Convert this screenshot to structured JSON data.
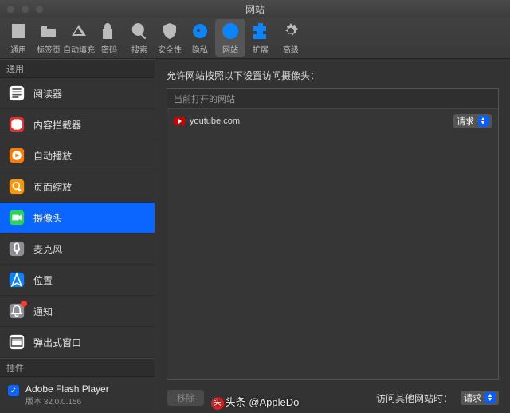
{
  "window": {
    "title": "网站"
  },
  "toolbar": {
    "items": [
      {
        "id": "general",
        "label": "通用",
        "selected": false
      },
      {
        "id": "tabs",
        "label": "标签页",
        "selected": false
      },
      {
        "id": "autofill",
        "label": "自动填充",
        "selected": false
      },
      {
        "id": "passwords",
        "label": "密码",
        "selected": false
      },
      {
        "id": "search",
        "label": "搜索",
        "selected": false
      },
      {
        "id": "security",
        "label": "安全性",
        "selected": false
      },
      {
        "id": "privacy",
        "label": "隐私",
        "selected": false
      },
      {
        "id": "websites",
        "label": "网站",
        "selected": true
      },
      {
        "id": "extensions",
        "label": "扩展",
        "selected": false
      },
      {
        "id": "advanced",
        "label": "高级",
        "selected": false
      }
    ]
  },
  "sidebar": {
    "general_header": "通用",
    "plugins_header": "插件",
    "items": [
      {
        "id": "reader",
        "label": "阅读器",
        "color": "#ffffff",
        "selected": false
      },
      {
        "id": "blockers",
        "label": "内容拦截器",
        "color": "#e03030",
        "selected": false
      },
      {
        "id": "autoplay",
        "label": "自动播放",
        "color": "#ff7a00",
        "selected": false
      },
      {
        "id": "zoom",
        "label": "页面缩放",
        "color": "#ff9500",
        "selected": false
      },
      {
        "id": "camera",
        "label": "摄像头",
        "color": "#30d158",
        "selected": true
      },
      {
        "id": "microphone",
        "label": "麦克风",
        "color": "#8e8e93",
        "selected": false
      },
      {
        "id": "location",
        "label": "位置",
        "color": "#0a84ff",
        "selected": false
      },
      {
        "id": "notifications",
        "label": "通知",
        "color": "#8e8e93",
        "selected": false,
        "badge": true
      },
      {
        "id": "popups",
        "label": "弹出式窗口",
        "color": "#ffffff",
        "selected": false
      }
    ],
    "plugin": {
      "name": "Adobe Flash Player",
      "version": "版本 32.0.0.156",
      "checked": true
    }
  },
  "main": {
    "heading": "允许网站按照以下设置访问摄像头：",
    "open_sites_header": "当前打开的网站",
    "sites": [
      {
        "domain": "youtube.com",
        "permission": "请求"
      }
    ],
    "remove_label": "移除",
    "other_sites_label": "访问其他网站时：",
    "default_permission": "请求"
  },
  "watermark": {
    "text": "头条 @AppleDo"
  }
}
